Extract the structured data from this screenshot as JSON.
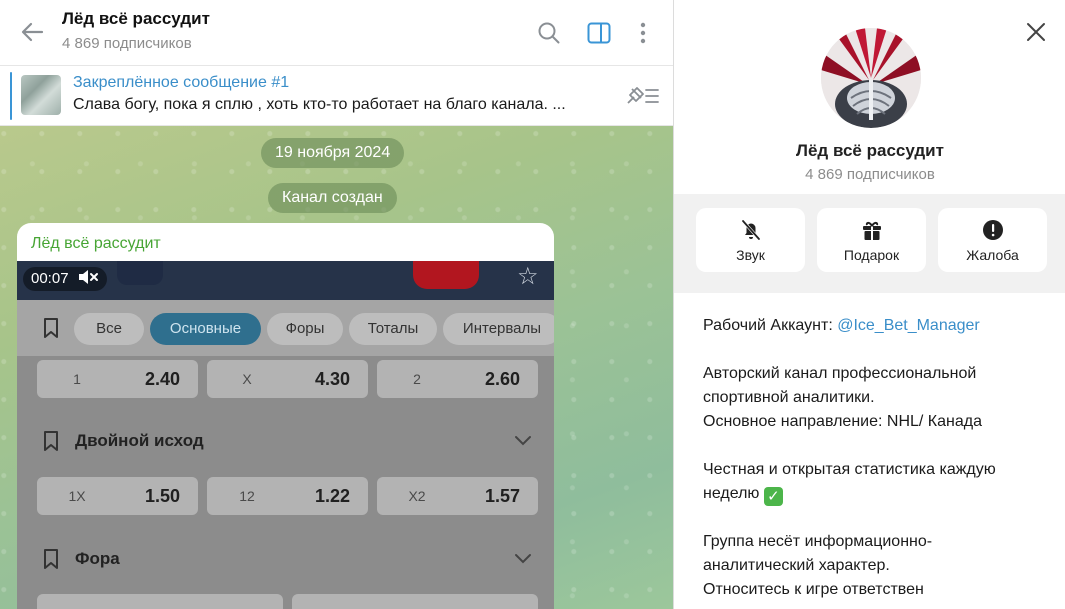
{
  "header": {
    "title": "Лёд всё рассудит",
    "subtitle": "4 869 подписчиков"
  },
  "pinned": {
    "title": "Закреплённое сообщение #1",
    "text": "Слава богу, пока я сплю , хоть кто-то работает на благо канала.  ..."
  },
  "chat": {
    "date_pill": "19 ноября 2024",
    "service_pill": "Канал создан",
    "message": {
      "sender": "Лёд всё рассудит",
      "video": {
        "time": "00:07",
        "tabs": [
          "Все",
          "Основные",
          "Форы",
          "Тоталы",
          "Интервалы"
        ],
        "active_tab": "Основные",
        "row1": [
          {
            "label": "1",
            "value": "2.40"
          },
          {
            "label": "X",
            "value": "4.30"
          },
          {
            "label": "2",
            "value": "2.60"
          }
        ],
        "section1": "Двойной исход",
        "row2": [
          {
            "label": "1X",
            "value": "1.50"
          },
          {
            "label": "12",
            "value": "1.22"
          },
          {
            "label": "X2",
            "value": "1.57"
          }
        ],
        "section2": "Фора"
      }
    }
  },
  "info": {
    "name": "Лёд всё рассудит",
    "subscribers": "4 869 подписчиков",
    "actions": [
      {
        "label": "Звук",
        "icon": "bell-off-icon"
      },
      {
        "label": "Подарок",
        "icon": "gift-icon"
      },
      {
        "label": "Жалоба",
        "icon": "report-icon"
      }
    ],
    "desc": {
      "p1_prefix": "Рабочий Аккаунт: ",
      "p1_link": "@Ice_Bet_Manager",
      "p2_line1": "Авторский канал профессиональной",
      "p2_line2": "спортивной аналитики.",
      "p2_line3": "Основное направление: NHL/ Канада",
      "p3_line1": "Честная и открытая статистика каждую",
      "p3_line2": "неделю",
      "p4_line1": "Группа несёт информационно-",
      "p4_line2": "аналитический характер.",
      "p4_line3": "Относитесь к игре ответствен"
    }
  },
  "colors": {
    "accent": "#3a8ec9",
    "sender": "#47a534",
    "active_tab": "#2f6f8e"
  }
}
